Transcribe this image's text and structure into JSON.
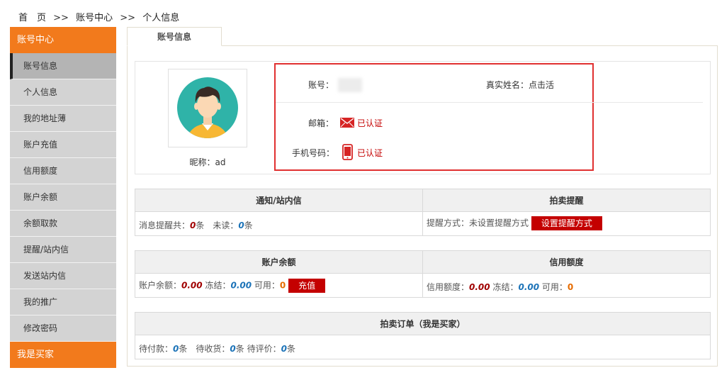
{
  "breadcrumb": {
    "home": "首　页",
    "sep": ">>",
    "level1": "账号中心",
    "level2": "个人信息"
  },
  "sidebar": {
    "header": "账号中心",
    "items": [
      {
        "label": "账号信息",
        "active": true
      },
      {
        "label": "个人信息"
      },
      {
        "label": "我的地址薄"
      },
      {
        "label": "账户充值"
      },
      {
        "label": "信用额度"
      },
      {
        "label": "账户余额"
      },
      {
        "label": "余额取款"
      },
      {
        "label": "提醒/站内信"
      },
      {
        "label": "发送站内信"
      },
      {
        "label": "我的推广"
      },
      {
        "label": "修改密码"
      }
    ],
    "footer": "我是买家"
  },
  "tab": {
    "label": "账号信息"
  },
  "profile": {
    "nickname": "昵称：ad",
    "account_label": "账号：",
    "realname": "真实姓名：点击活",
    "email_label": "邮箱：",
    "email_status": "已认证",
    "phone_label": "手机号码：",
    "phone_status": "已认证"
  },
  "notify": {
    "head": "通知/站内信",
    "prefix": "消息提醒共：",
    "total": "0",
    "unit1": "条　未读：",
    "unread": "0",
    "unit2": "条"
  },
  "auction_remind": {
    "head": "拍卖提醒",
    "text": "提醒方式：未设置提醒方式",
    "button": "设置提醒方式"
  },
  "balance": {
    "head": "账户余额",
    "label1": "账户余额：",
    "amount": "0.00",
    "label2": "冻结：",
    "frozen": "0.00",
    "label3": "可用：",
    "available": "0",
    "button": "充值"
  },
  "credit": {
    "head": "信用额度",
    "label1": "信用额度：",
    "amount": "0.00",
    "label2": "冻结：",
    "frozen": "0.00",
    "label3": "可用：",
    "available": "0"
  },
  "orders": {
    "head": "拍卖订单（我是买家）",
    "label1": "待付款：",
    "pending_pay": "0",
    "unit1": "条　待收货：",
    "pending_receive": "0",
    "unit2": "条 待评价：",
    "pending_review": "0",
    "unit3": "条"
  }
}
